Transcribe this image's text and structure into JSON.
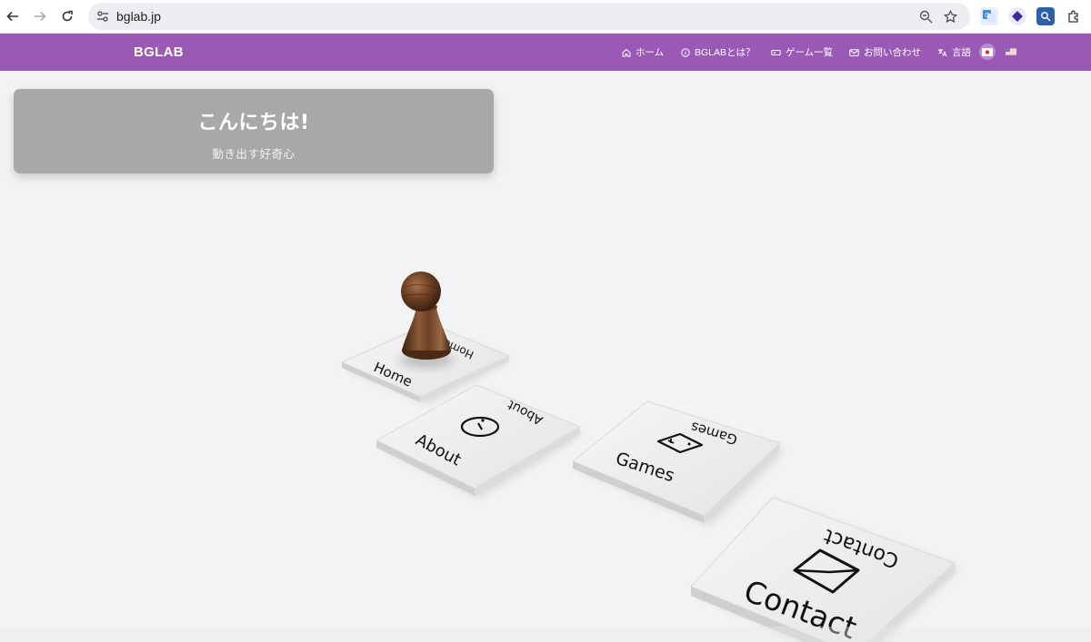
{
  "browser": {
    "url": "bglab.jp",
    "back_icon": "arrow-left-icon",
    "forward_icon": "arrow-right-icon",
    "reload_icon": "reload-icon",
    "zoom_icon": "zoom-icon",
    "bookmark_icon": "star-icon",
    "extensions": [
      "translate-extension-icon",
      "purple-diamond-extension-icon",
      "search-extension-icon",
      "puzzle-extensions-icon"
    ]
  },
  "site": {
    "brand": "BGLAB",
    "nav": {
      "home": "ホーム",
      "about": "BGLABとは？",
      "games": "ゲーム一覧",
      "contact": "お問い合わせ",
      "language": "言語"
    },
    "accent_color": "#9b59b6"
  },
  "hero": {
    "title": "こんにちは!",
    "subtitle": "動き出す好奇心"
  },
  "board": {
    "tiles": [
      {
        "label": "Home",
        "back_label": "Home"
      },
      {
        "label": "About",
        "back_label": "About",
        "icon": "info-icon"
      },
      {
        "label": "Games",
        "back_label": "Games",
        "icon": "gamepad-icon"
      },
      {
        "label": "Contact",
        "back_label": "Contact",
        "icon": "envelope-icon"
      }
    ],
    "piece": "wooden-pawn"
  }
}
